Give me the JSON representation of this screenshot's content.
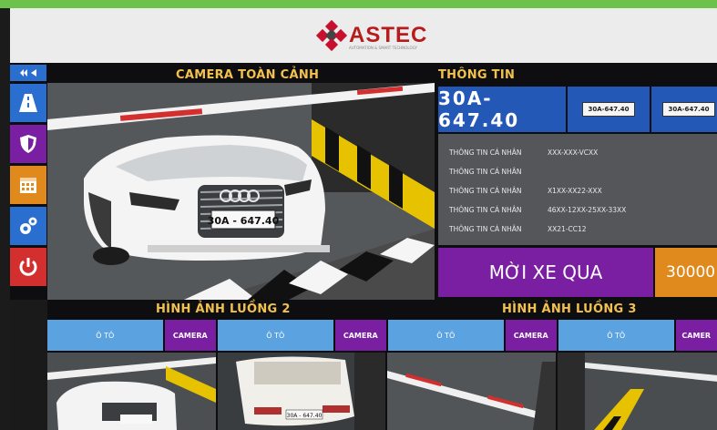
{
  "header": {
    "logo_text": "ASTEC",
    "logo_sub": "AUTOMATION & SMART TECHNOLOGY"
  },
  "sidebar": {
    "top_icons": [
      "double-arrow-left-icon",
      "arrow-left-icon"
    ],
    "buttons": [
      {
        "name": "road-icon",
        "color": "#2a6fd0"
      },
      {
        "name": "shield-icon",
        "color": "#7b1fa2"
      },
      {
        "name": "calendar-icon",
        "color": "#e08a1e"
      },
      {
        "name": "gears-icon",
        "color": "#2a6fd0"
      },
      {
        "name": "power-icon",
        "color": "#d32f2f"
      }
    ]
  },
  "camera_main": {
    "title": "CAMERA TOÀN CẢNH",
    "plate": "30A - 647.40"
  },
  "info": {
    "title": "THÔNG TIN",
    "plate_big": "30A-647.40",
    "plate_mid": "30A-647.40",
    "plate_right": "30A-647.40",
    "rows": [
      {
        "label": "THÔNG TIN CÁ NHÂN",
        "value": "XXX-XXX-VCXX"
      },
      {
        "label": "THÔNG TIN CÁ NHÂN",
        "value": ""
      },
      {
        "label": "THÔNG TIN CÁ NHÂN",
        "value": "X1XX-XX22-XXX"
      },
      {
        "label": "THÔNG TIN CÁ NHÂN",
        "value": "46XX-12XX-25XX-33XX"
      },
      {
        "label": "THÔNG TIN CÁ NHÂN",
        "value": "XX21-CC12"
      }
    ],
    "welcome": "MỜI XE QUA",
    "amount": "30000"
  },
  "lanes": {
    "lane2_title": "HÌNH ẢNH LUỒNG 2",
    "lane3_title": "HÌNH ẢNH LUỒNG 3",
    "buttons": [
      {
        "oto": "Ô TÔ",
        "camera": "CAMERA"
      },
      {
        "oto": "Ô TÔ",
        "camera": "CAMERA"
      },
      {
        "oto": "Ô TÔ",
        "camera": "CAMERA"
      },
      {
        "oto": "Ô TÔ",
        "camera": "CAMER"
      }
    ],
    "thumb_plate": "30A - 647.40"
  },
  "colors": {
    "accent_green": "#6cc24a",
    "blue": "#2458b7",
    "purple": "#7b1fa2",
    "orange": "#e08a1e",
    "title_yellow": "#f2c14e"
  }
}
